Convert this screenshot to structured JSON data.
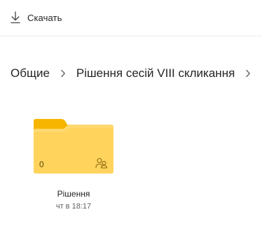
{
  "toolbar": {
    "download_label": "Скачать",
    "download_icon": "download-arrow-icon"
  },
  "breadcrumb": {
    "items": [
      "Общие",
      "Рішення сесій VIII скликання"
    ],
    "separator_icon": "chevron-right-icon"
  },
  "folder": {
    "name": "Рішення",
    "modified": "чт в 18:17",
    "item_count": "0",
    "shared_icon": "people-shared-icon",
    "colors": {
      "front": "#ffd35c",
      "back": "#f7b500"
    }
  }
}
